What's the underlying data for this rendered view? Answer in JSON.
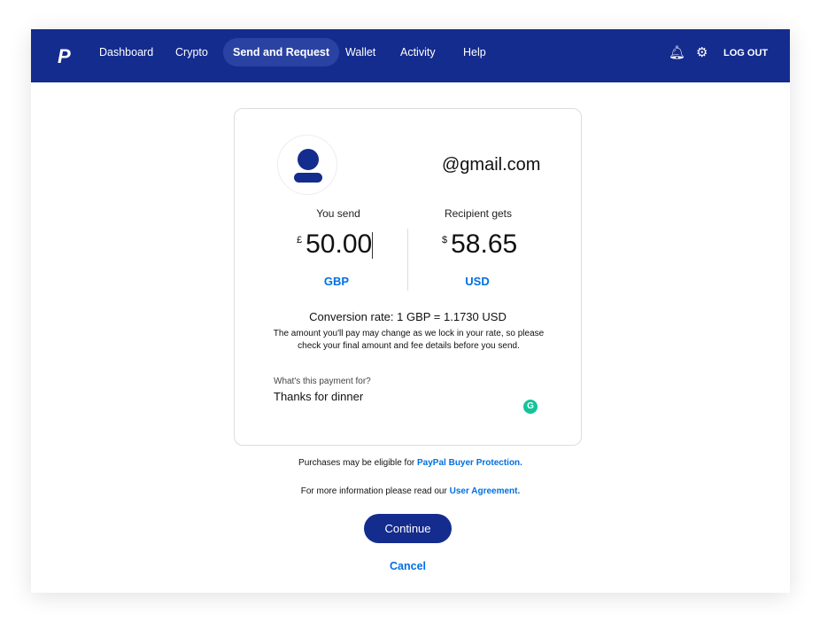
{
  "nav": {
    "items": [
      "Dashboard",
      "Crypto",
      "Send and Request",
      "Wallet",
      "Activity",
      "Help"
    ],
    "active": "Send and Request",
    "logout": "LOG OUT",
    "logo": "P"
  },
  "recipient": {
    "email": "@gmail.com"
  },
  "send": {
    "label": "You send",
    "symbol": "£",
    "amount": "50.00",
    "currency": "GBP"
  },
  "receive": {
    "label": "Recipient gets",
    "symbol": "$",
    "amount": "58.65",
    "currency": "USD"
  },
  "rate": "Conversion rate: 1 GBP = 1.1730 USD",
  "note": "The amount you'll pay may change as we lock in your rate, so please check your final amount and fee details before you send.",
  "purpose": {
    "label": "What's this payment for?",
    "value": "Thanks for dinner"
  },
  "protection": {
    "text": "Purchases may be eligible for ",
    "link": "PayPal Buyer Protection."
  },
  "agreement": {
    "text": "For more information please read our ",
    "link": "User Agreement."
  },
  "continue": "Continue",
  "cancel": "Cancel",
  "colors": {
    "brand": "#142c8e",
    "link": "#0070e0"
  }
}
